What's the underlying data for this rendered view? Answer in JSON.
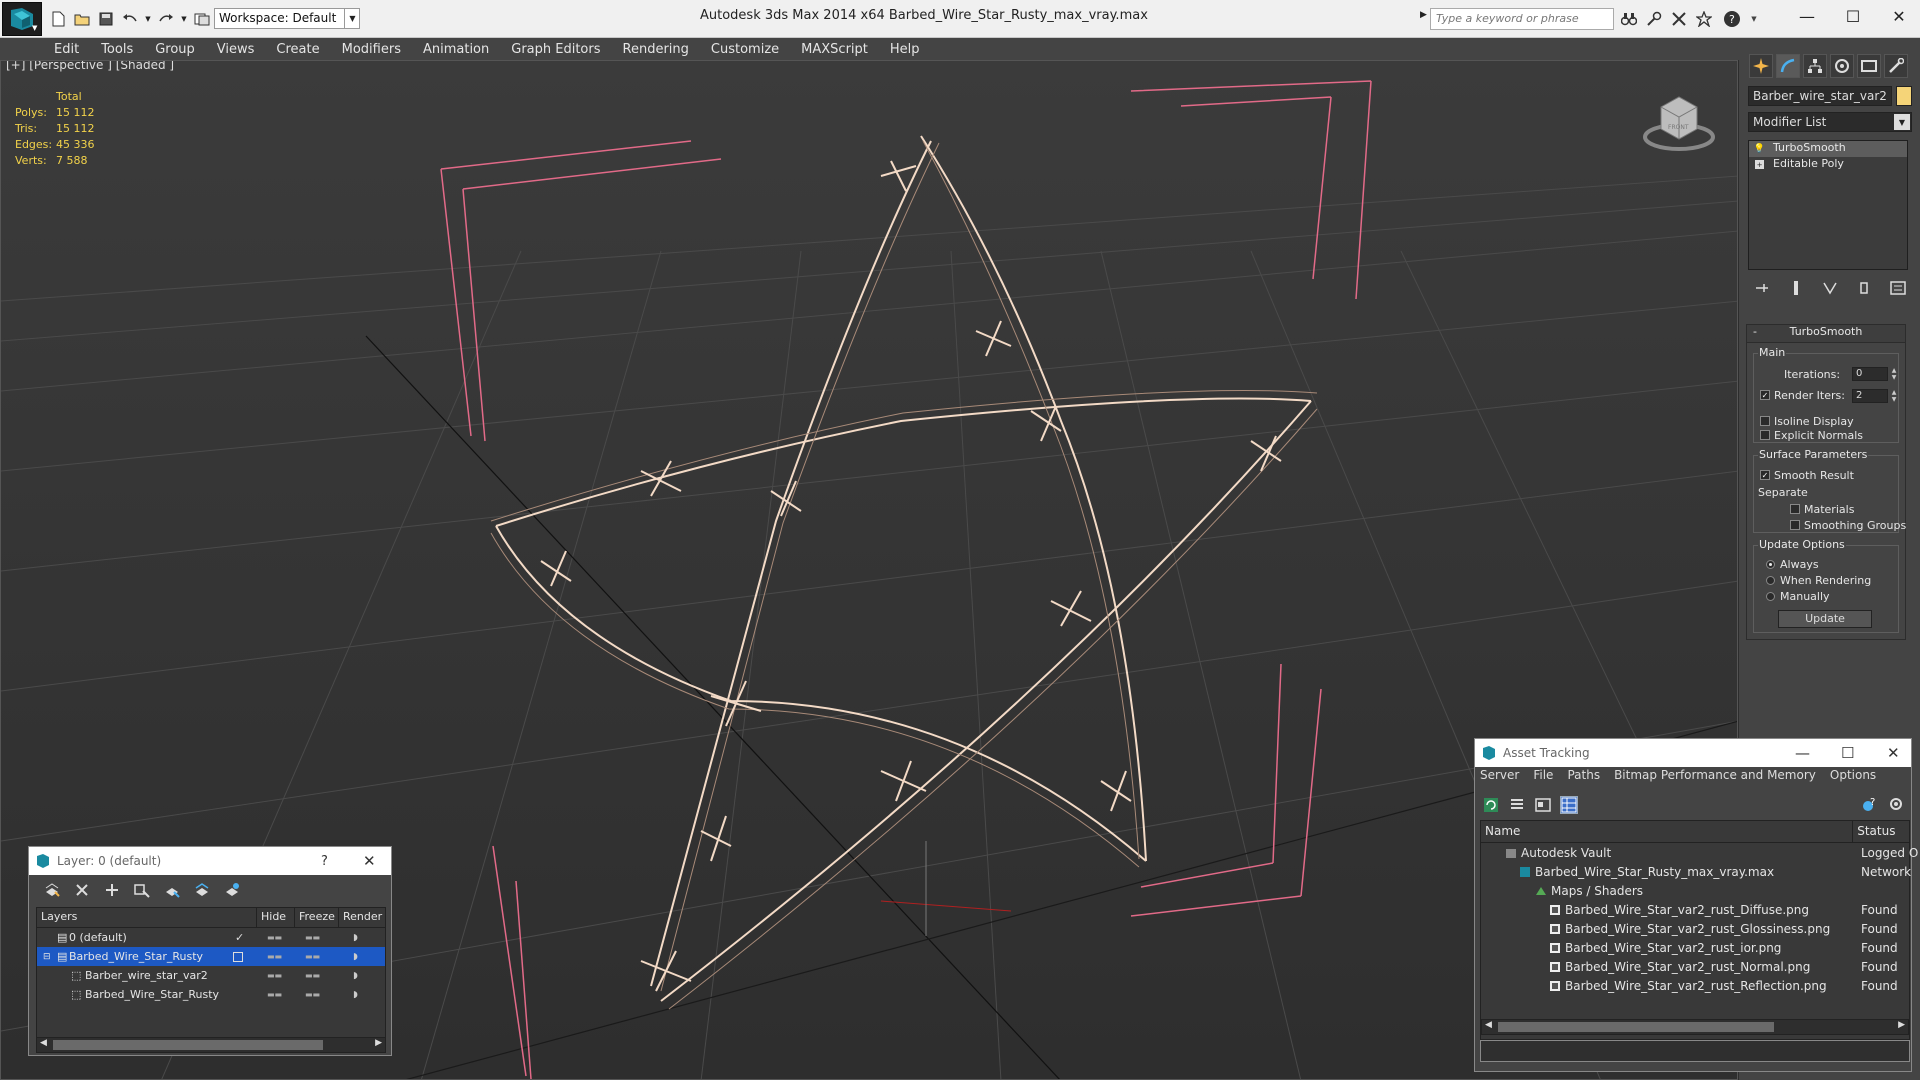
{
  "app_title": "Autodesk 3ds Max  2014 x64      Barbed_Wire_Star_Rusty_max_vray.max",
  "workspace": "Workspace: Default",
  "search_placeholder": "Type a keyword or phrase",
  "menu": [
    "Edit",
    "Tools",
    "Group",
    "Views",
    "Create",
    "Modifiers",
    "Animation",
    "Graph Editors",
    "Rendering",
    "Customize",
    "MAXScript",
    "Help"
  ],
  "viewport": {
    "label": "[+] [Perspective ] [Shaded ]",
    "stats_header": "Total",
    "stats": [
      {
        "k": "Polys:",
        "v": "15 112"
      },
      {
        "k": "Tris:",
        "v": "15 112"
      },
      {
        "k": "Edges:",
        "v": "45 336"
      },
      {
        "k": "Verts:",
        "v": "7 588"
      }
    ]
  },
  "command_panel": {
    "object_name": "Barber_wire_star_var2",
    "modifier_list": "Modifier List",
    "stack": [
      "TurboSmooth",
      "Editable Poly"
    ],
    "rollout_title": "TurboSmooth",
    "main_label": "Main",
    "iterations_label": "Iterations:",
    "iterations_value": "0",
    "render_iters_label": "Render Iters:",
    "render_iters_value": "2",
    "isoline": "Isoline Display",
    "explicit_normals": "Explicit Normals",
    "surface_params": "Surface Parameters",
    "smooth_result": "Smooth Result",
    "separate": "Separate",
    "materials": "Materials",
    "smoothing_groups": "Smoothing Groups",
    "update_options": "Update Options",
    "always": "Always",
    "when_rendering": "When Rendering",
    "manually": "Manually",
    "update_btn": "Update"
  },
  "layer_dialog": {
    "title": "Layer: 0 (default)",
    "help": "?",
    "close": "✕",
    "cols": [
      "Layers",
      "Hide",
      "Freeze",
      "Render"
    ],
    "rows": [
      {
        "name": "0 (default)"
      },
      {
        "name": "Barbed_Wire_Star_Rusty"
      },
      {
        "name": "Barber_wire_star_var2"
      },
      {
        "name": "Barbed_Wire_Star_Rusty"
      }
    ]
  },
  "asset_tracking": {
    "title": "Asset Tracking",
    "menu": [
      "Server",
      "File",
      "Paths",
      "Bitmap Performance and Memory",
      "Options"
    ],
    "cols": [
      "Name",
      "Status"
    ],
    "rows": [
      {
        "name": "Autodesk Vault",
        "status": "Logged O"
      },
      {
        "name": "Barbed_Wire_Star_Rusty_max_vray.max",
        "status": "Network"
      },
      {
        "name": "Maps / Shaders",
        "status": ""
      },
      {
        "name": "Barbed_Wire_Star_var2_rust_Diffuse.png",
        "status": "Found"
      },
      {
        "name": "Barbed_Wire_Star_var2_rust_Glossiness.png",
        "status": "Found"
      },
      {
        "name": "Barbed_Wire_Star_var2_rust_ior.png",
        "status": "Found"
      },
      {
        "name": "Barbed_Wire_Star_var2_rust_Normal.png",
        "status": "Found"
      },
      {
        "name": "Barbed_Wire_Star_var2_rust_Reflection.png",
        "status": "Found"
      }
    ]
  },
  "colors": {
    "accent": "#1d59c4",
    "stats": "#f2d24a",
    "wire": "#f3dac6",
    "bbox": "#e26a88"
  }
}
